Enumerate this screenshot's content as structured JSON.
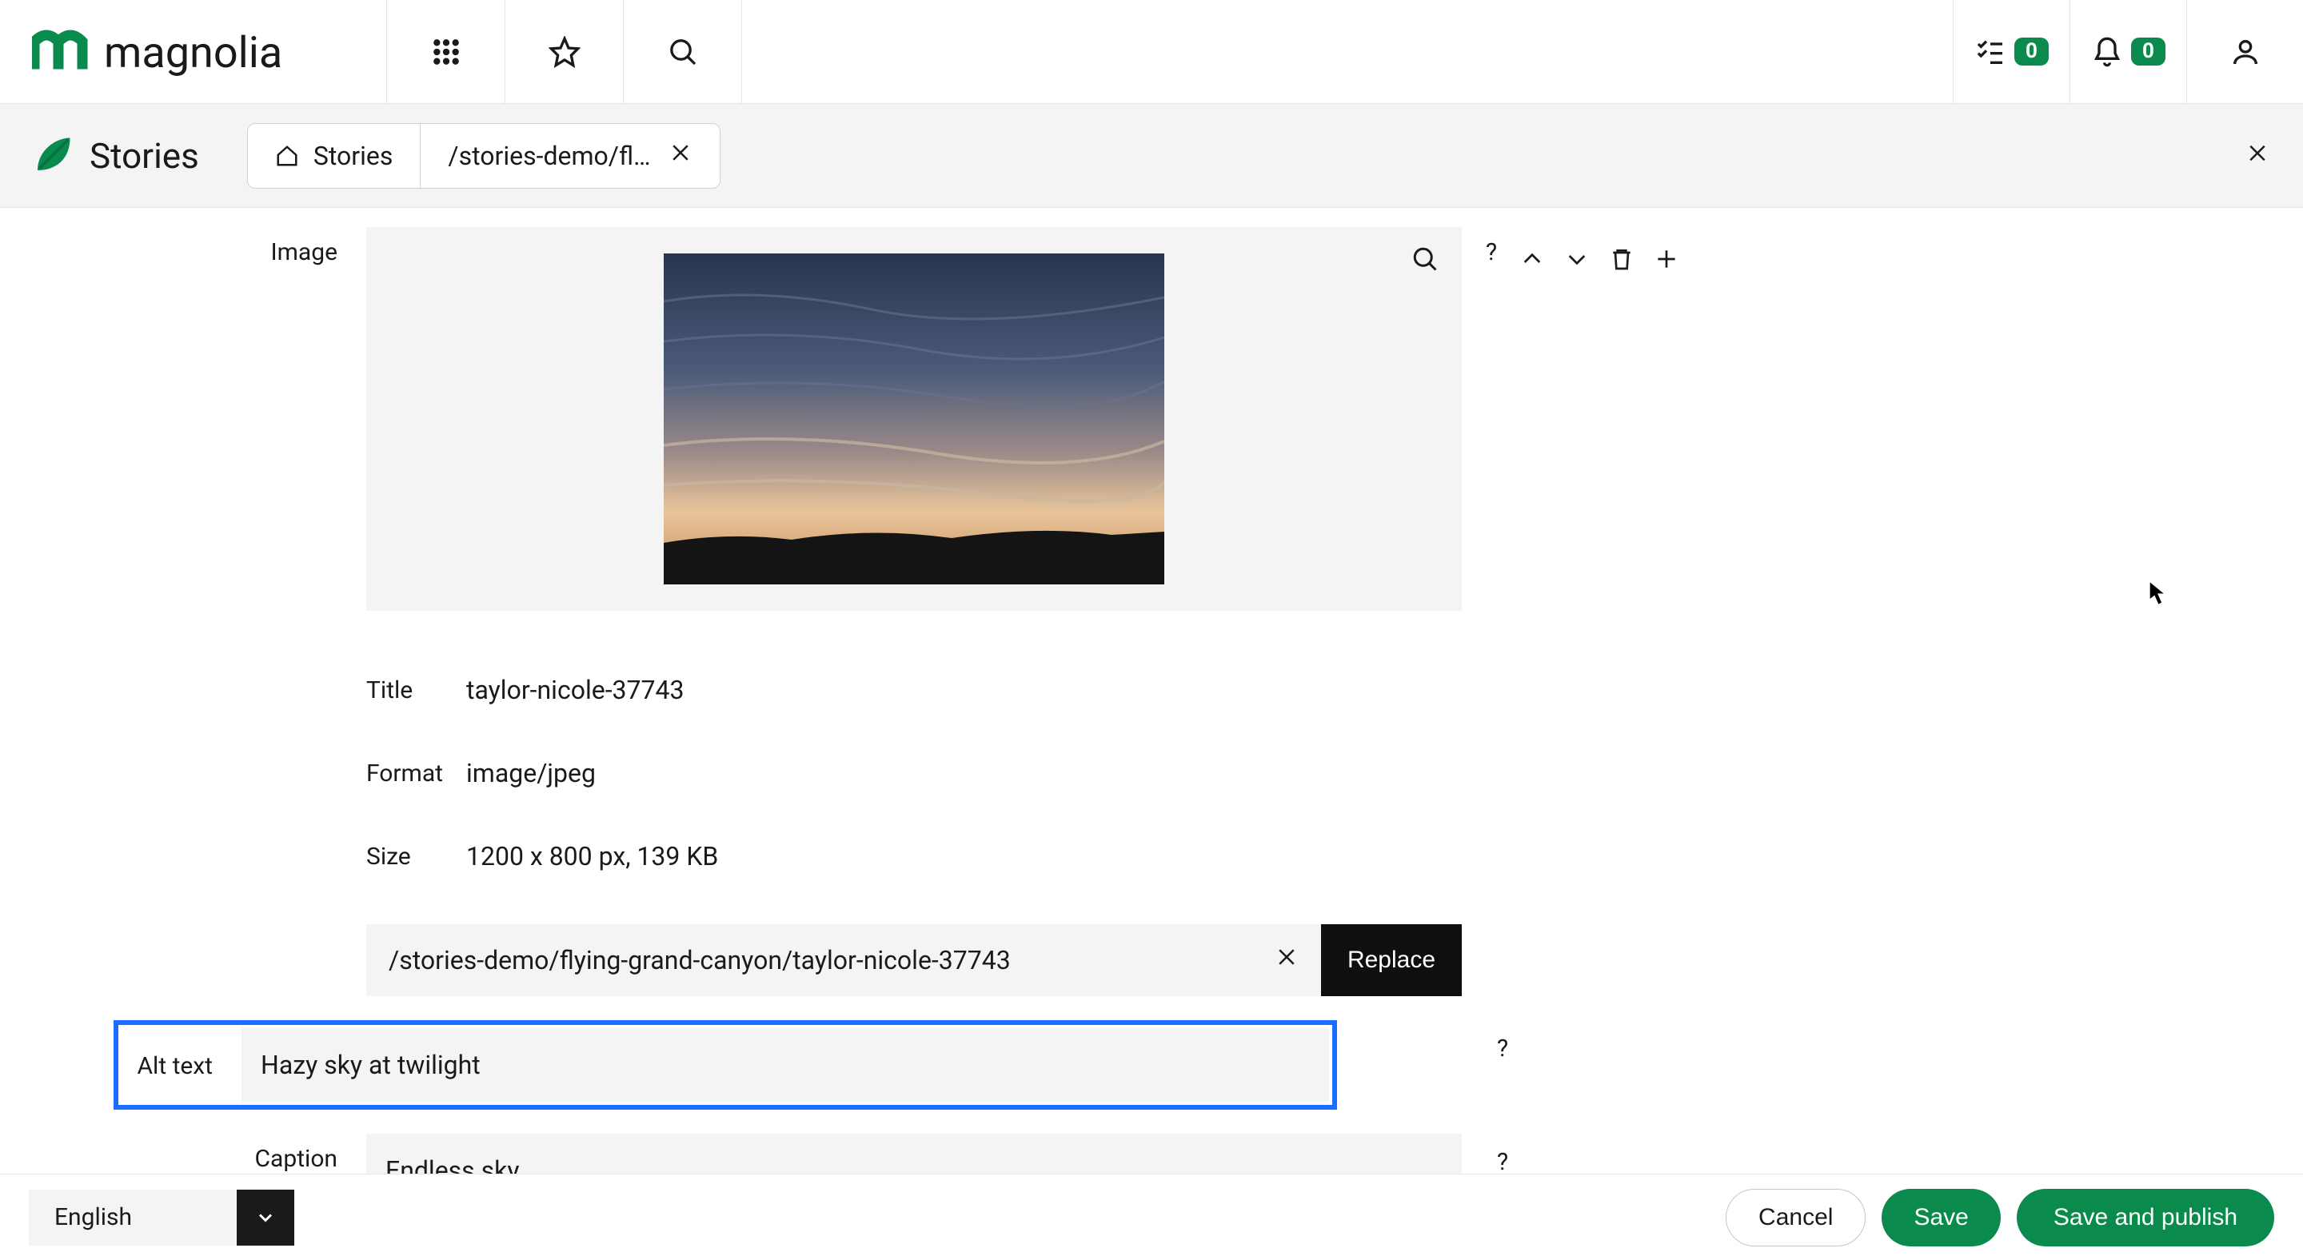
{
  "brand": "magnolia",
  "header": {
    "tasks_count": "0",
    "notifications_count": "0"
  },
  "app": {
    "title": "Stories",
    "tabs": [
      {
        "label": "Stories"
      },
      {
        "label": "/stories-demo/fl…"
      }
    ]
  },
  "form": {
    "labels": {
      "image": "Image",
      "title": "Title",
      "format": "Format",
      "size": "Size",
      "alt": "Alt text",
      "caption": "Caption"
    },
    "values": {
      "title": "taylor-nicole-37743",
      "format": "image/jpeg",
      "size": "1200 x 800 px, 139 KB",
      "path": "/stories-demo/flying-grand-canyon/taylor-nicole-37743",
      "alt": "Hazy sky at twilight",
      "caption": "Endless sky"
    },
    "buttons": {
      "replace": "Replace"
    }
  },
  "footer": {
    "language": "English",
    "cancel": "Cancel",
    "save": "Save",
    "save_publish": "Save and publish"
  },
  "help_mark": "?"
}
